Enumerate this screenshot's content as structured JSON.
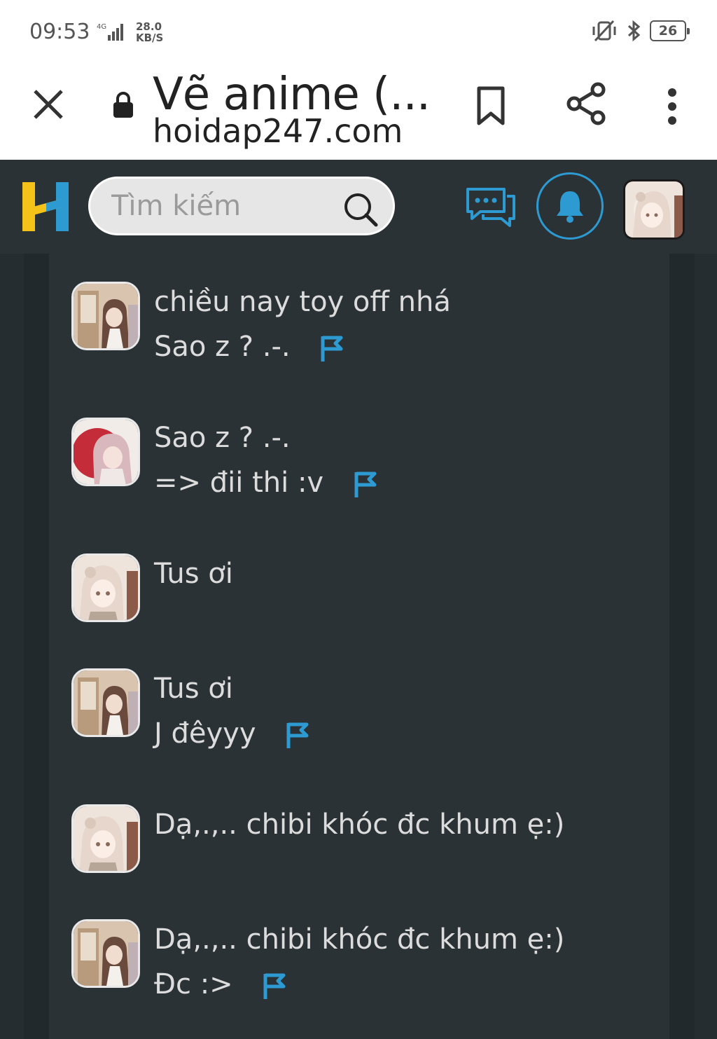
{
  "status_bar": {
    "time": "09:53",
    "network": "4G",
    "speed_value": "28.0",
    "speed_unit": "KB/S",
    "battery": "26"
  },
  "browser": {
    "title": "Vẽ anime (...",
    "url": "hoidap247.com"
  },
  "site_header": {
    "search_placeholder": "Tìm kiếm",
    "logo_colors": {
      "left": "#f5c21a",
      "right": "#2d9bd1"
    },
    "accent": "#2d9bd1"
  },
  "messages": [
    {
      "avatar": "avatar-girl-window",
      "lines": [
        "chiều nay toy off nhá",
        "Sao z ? .-."
      ],
      "flag": true
    },
    {
      "avatar": "avatar-girl-red",
      "lines": [
        "Sao z ? .-.",
        "=> đii thi :v"
      ],
      "flag": true
    },
    {
      "avatar": "avatar-girl-light",
      "lines": [
        "Tus ơi"
      ],
      "flag": false
    },
    {
      "avatar": "avatar-girl-window",
      "lines": [
        "Tus ơi",
        "J đêyyy"
      ],
      "flag": true
    },
    {
      "avatar": "avatar-girl-light",
      "lines": [
        "Dạ,.,.. chibi khóc đc khum ẹ:)"
      ],
      "flag": false
    },
    {
      "avatar": "avatar-girl-window",
      "lines": [
        "Dạ,.,.. chibi khóc đc khum ẹ:)",
        "Đc :>"
      ],
      "flag": true
    }
  ]
}
